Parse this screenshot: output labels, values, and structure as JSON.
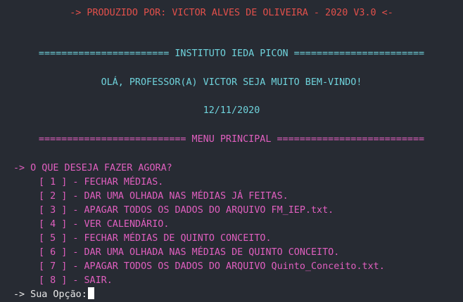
{
  "terminal": {
    "credit": "-> PRODUZIDO POR: VICTOR ALVES DE OLIVEIRA - 2020 V3.0 <-",
    "institute_banner": "======================= INSTITUTO IEDA PICON =======================",
    "greeting": "OLÁ, PROFESSOR(A) VICTOR SEJA MUITO BEM-VINDO!",
    "date": "12/11/2020",
    "menu_banner": "========================== MENU PRINCIPAL ==========================",
    "question": "-> O QUE DESEJA FAZER AGORA?",
    "options": [
      "[ 1 ] - FECHAR MÉDIAS.",
      "[ 2 ] - DAR UMA OLHADA NAS MÉDIAS JÁ FEITAS.",
      "[ 3 ] - APAGAR TODOS OS DADOS DO ARQUIVO FM_IEP.txt.",
      "[ 4 ] - VER CALENDÁRIO.",
      "[ 5 ] - FECHAR MÉDIAS DE QUINTO CONCEITO.",
      "[ 6 ] - DAR UMA OLHADA NAS MÉDIAS DE QUINTO CONCEITO.",
      "[ 7 ] - APAGAR TODOS OS DADOS DO ARQUIVO Quinto_Conceito.txt.",
      "[ 8 ] - SAIR."
    ],
    "prompt": "-> Sua Opção:"
  },
  "colors": {
    "background": "#272b33",
    "credit": "#e2504b",
    "banner": "#6fd3dc",
    "menu": "#e05fbf",
    "prompt": "#e8e8e8"
  }
}
